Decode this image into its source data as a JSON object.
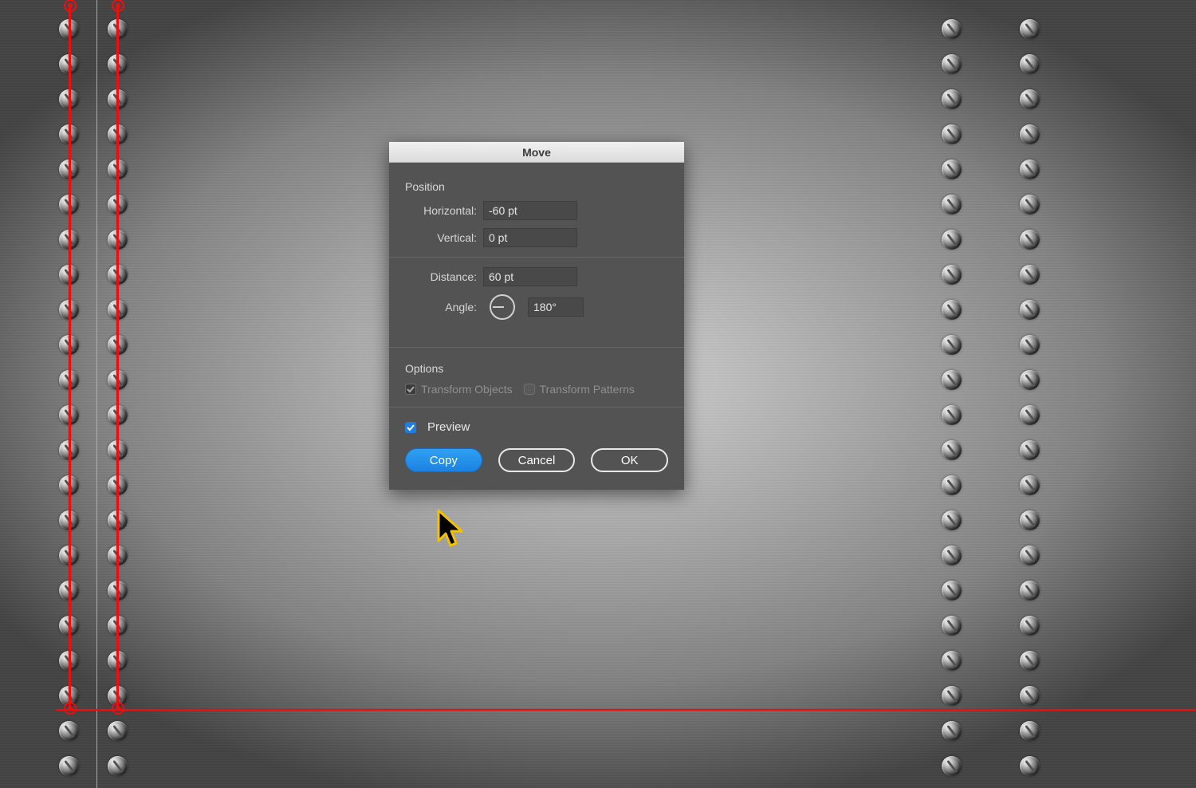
{
  "dialog": {
    "title": "Move",
    "position": {
      "group_title": "Position",
      "horizontal_label": "Horizontal:",
      "horizontal_value": "-60 pt",
      "vertical_label": "Vertical:",
      "vertical_value": "0 pt",
      "distance_label": "Distance:",
      "distance_value": "60 pt",
      "angle_label": "Angle:",
      "angle_value": "180°"
    },
    "options": {
      "group_title": "Options",
      "transform_objects_label": "Transform Objects",
      "transform_objects_checked": true,
      "transform_patterns_label": "Transform Patterns",
      "transform_patterns_checked": false
    },
    "preview": {
      "label": "Preview",
      "checked": true
    },
    "buttons": {
      "copy": "Copy",
      "cancel": "Cancel",
      "ok": "OK"
    }
  }
}
